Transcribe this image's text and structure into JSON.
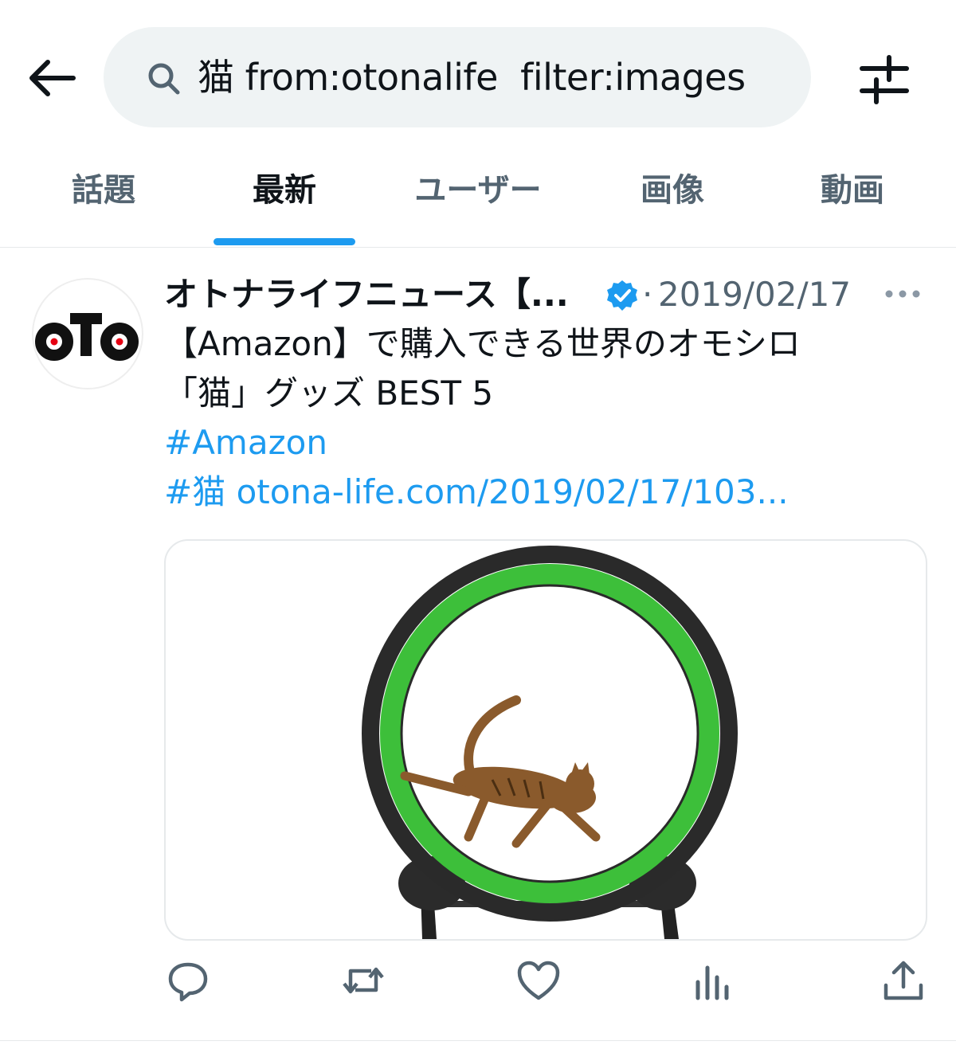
{
  "search": {
    "query": "猫 from:otonalife  filter:images"
  },
  "tabs": [
    {
      "label": "話題"
    },
    {
      "label": "最新"
    },
    {
      "label": "ユーザー"
    },
    {
      "label": "画像"
    },
    {
      "label": "動画"
    }
  ],
  "active_tab": "最新",
  "tweet": {
    "display_name": "オトナライフニュース【...",
    "separator": "·",
    "timestamp": "2019/02/17",
    "avatar_text": "oTo",
    "lines": [
      "【Amazon】で購入できる世界のオモシロ",
      "「猫」グッズ BEST 5"
    ],
    "hashtag_1": "#Amazon",
    "hashtag_2": "#猫",
    "link": "otona-life.com/2019/02/17/103..."
  },
  "colors": {
    "accent": "#1d9bf0",
    "text_primary": "#0f1419",
    "text_secondary": "#536471",
    "search_bg": "#eff3f4",
    "wheel_green": "#3dbf3a"
  },
  "icons": {
    "back": "arrow-left-icon",
    "search": "search-icon",
    "filter": "sliders-icon",
    "verified": "verified-badge-icon",
    "more": "more-horizontal-icon",
    "reply": "reply-icon",
    "retweet": "retweet-icon",
    "like": "heart-icon",
    "views": "views-bar-chart-icon",
    "share": "share-icon"
  }
}
